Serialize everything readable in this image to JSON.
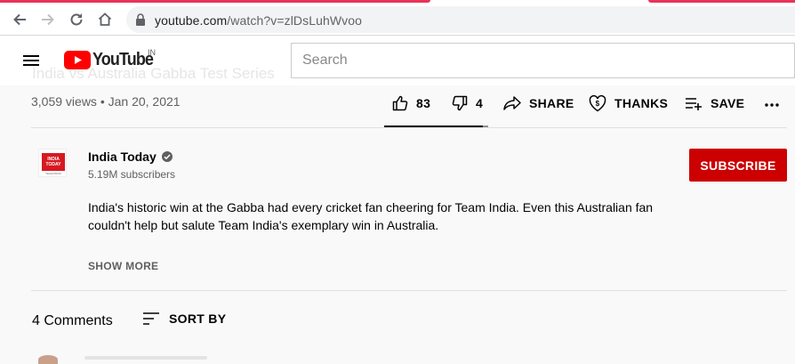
{
  "browser": {
    "url_host": "youtube.com",
    "url_path": "/watch?v=zlDsLuhWvoo",
    "icons": [
      "back-icon",
      "forward-icon",
      "reload-icon",
      "home-icon",
      "lock-icon"
    ]
  },
  "header": {
    "logo_text": "YouTube",
    "country": "IN",
    "search_placeholder": "Search",
    "ghost_title": "India vs Australia Gabba Test Series"
  },
  "video": {
    "stats": "3,059 views • Jan 20, 2021",
    "likes": "83",
    "dislikes": "4",
    "share_label": "SHARE",
    "thanks_label": "THANKS",
    "save_label": "SAVE"
  },
  "channel": {
    "name": "India Today",
    "subscribers": "5.19M subscribers",
    "logo_text": "INDIA TODAY",
    "logo_subtext": "TELEVISION",
    "subscribe_label": "SUBSCRIBE"
  },
  "description": {
    "text": "India's historic win at the Gabba had every cricket fan cheering for Team India. Even this Australian fan couldn't help but salute Team India's exemplary win in Australia.",
    "show_more": "SHOW MORE"
  },
  "comments": {
    "count_label": "4 Comments",
    "sort_label": "SORT BY"
  },
  "colors": {
    "brand_red": "#ff0000",
    "subscribe_red": "#cc0000",
    "tab_accent": "#e8335a"
  }
}
